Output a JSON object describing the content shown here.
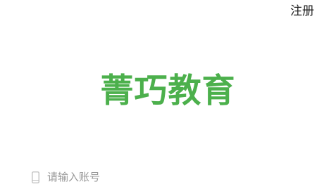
{
  "header": {
    "register_label": "注册"
  },
  "logo": {
    "text": "菁巧教育",
    "color": "#4cb04c"
  },
  "account": {
    "icon": "phone-icon",
    "placeholder": "请输入账号",
    "value": ""
  }
}
